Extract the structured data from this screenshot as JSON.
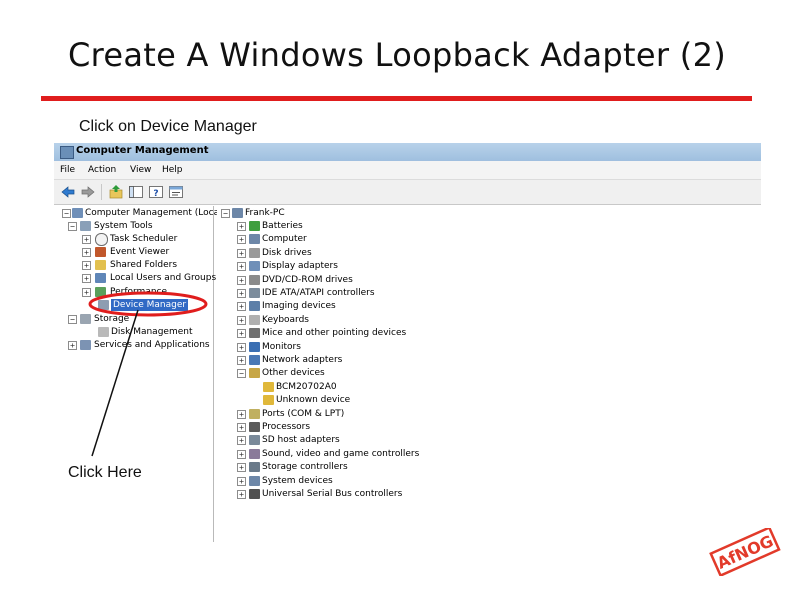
{
  "slide": {
    "title": "Create A Windows Loopback Adapter (2)",
    "caption": "Click on Device Manager",
    "annotation": "Click Here",
    "accent_color": "#e01d1d",
    "logo_text": "AfNOG"
  },
  "window": {
    "title": "Computer Management",
    "menu": [
      "File",
      "Action",
      "View",
      "Help"
    ]
  },
  "left_tree": [
    {
      "label": "Computer Management (Local)",
      "icon": "computer-management-icon"
    },
    {
      "label": "System Tools",
      "icon": "tools-icon"
    },
    {
      "label": "Task Scheduler",
      "icon": "clock-icon"
    },
    {
      "label": "Event Viewer",
      "icon": "event-viewer-icon"
    },
    {
      "label": "Shared Folders",
      "icon": "shared-folder-icon"
    },
    {
      "label": "Local Users and Groups",
      "icon": "users-icon"
    },
    {
      "label": "Performance",
      "icon": "performance-icon"
    },
    {
      "label": "Device Manager",
      "icon": "device-manager-icon",
      "selected": true
    },
    {
      "label": "Storage",
      "icon": "storage-icon"
    },
    {
      "label": "Disk Management",
      "icon": "disk-icon"
    },
    {
      "label": "Services and Applications",
      "icon": "services-icon"
    }
  ],
  "right_tree": {
    "root": "Frank-PC",
    "items": [
      "Batteries",
      "Computer",
      "Disk drives",
      "Display adapters",
      "DVD/CD-ROM drives",
      "IDE ATA/ATAPI controllers",
      "Imaging devices",
      "Keyboards",
      "Mice and other pointing devices",
      "Monitors",
      "Network adapters",
      "Other devices",
      "BCM20702A0",
      "Unknown device",
      "Ports (COM & LPT)",
      "Processors",
      "SD host adapters",
      "Sound, video and game controllers",
      "Storage controllers",
      "System devices",
      "Universal Serial Bus controllers"
    ]
  }
}
